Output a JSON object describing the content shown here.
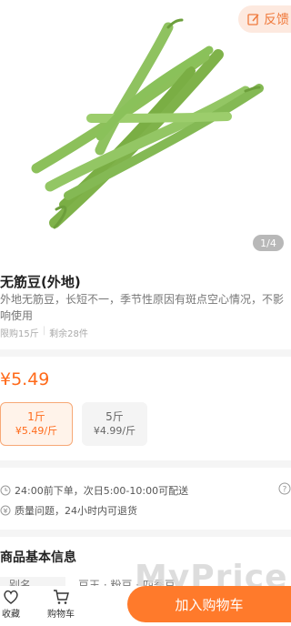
{
  "header": {
    "feedback_label": "反馈"
  },
  "gallery": {
    "page_indicator": "1/4"
  },
  "product": {
    "name": "无筋豆(外地)",
    "description": "外地无筋豆，长短不一，季节性原因有斑点空心情况，不影响使用",
    "limit_text": "限购15斤",
    "stock_text": "剩余28件",
    "price": "¥5.49"
  },
  "specs": [
    {
      "unit": "1斤",
      "unit_price": "¥5.49/斤"
    },
    {
      "unit": "5斤",
      "unit_price": "¥4.99/斤"
    }
  ],
  "services": [
    {
      "icon": "clock-icon",
      "text": "24:00前下单，次日5:00-10:00可配送"
    },
    {
      "icon": "refund-icon",
      "text": "质量问题，24小时内可退货"
    }
  ],
  "basic_info": {
    "title": "商品基本信息",
    "rows": [
      {
        "label": "别名",
        "value": "豆王 · 粉豆 · 四季豆"
      }
    ]
  },
  "watermark": "MyPrice",
  "bottom_bar": {
    "favorite_label": "收藏",
    "cart_label": "购物车",
    "add_to_cart_label": "加入购物车"
  },
  "colors": {
    "accent": "#ff6a1a",
    "button": "#ff7a2b",
    "feedback_bg": "#fde9df"
  }
}
